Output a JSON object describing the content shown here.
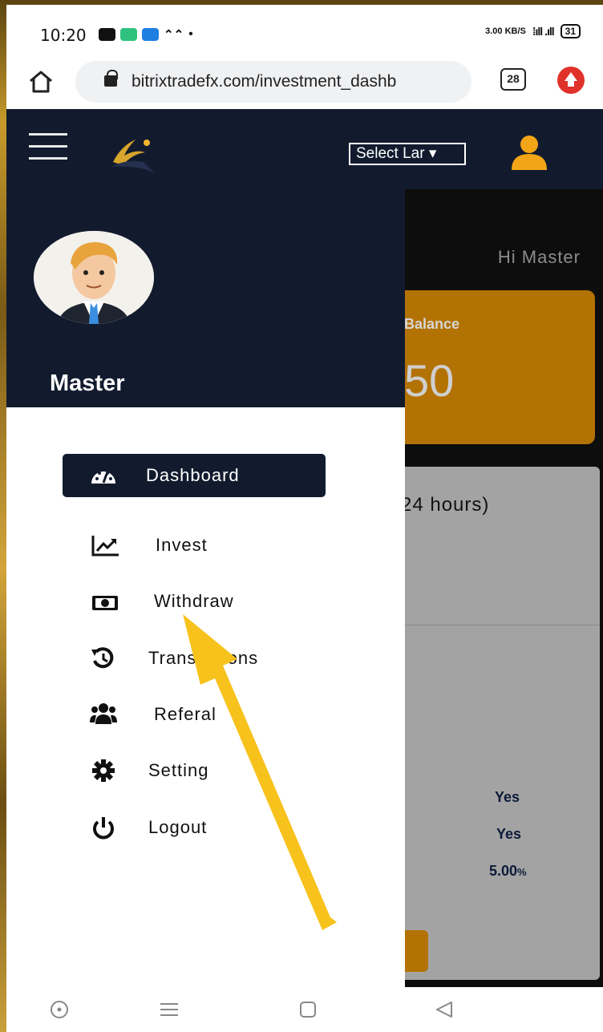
{
  "status_bar": {
    "time": "10:20",
    "net_speed": "3.00 KB/S",
    "battery": "31"
  },
  "browser": {
    "url": "bitrixtradefx.com/investment_dashb",
    "tab_count": "28"
  },
  "header": {
    "language_select": "Select Lar ▾"
  },
  "background_page": {
    "greeting": "Hi Master",
    "balance_label": "Balance",
    "balance_value": "50",
    "hours_text": "24 hours)",
    "yes_1": "Yes",
    "yes_2": "Yes",
    "percent": "5.00",
    "percent_sign": "%"
  },
  "drawer": {
    "username": "Master",
    "items": [
      {
        "label": "Dashboard",
        "icon": "dashboard-icon",
        "active": true
      },
      {
        "label": "Invest",
        "icon": "chart-line-icon",
        "active": false
      },
      {
        "label": "Withdraw",
        "icon": "money-bill-icon",
        "active": false
      },
      {
        "label": "Transactions",
        "icon": "history-icon",
        "active": false
      },
      {
        "label": "Referal",
        "icon": "users-icon",
        "active": false
      },
      {
        "label": "Setting",
        "icon": "gear-icon",
        "active": false
      },
      {
        "label": "Logout",
        "icon": "power-icon",
        "active": false
      }
    ]
  },
  "colors": {
    "navy": "#121b2e",
    "gold": "#b37204",
    "arrow": "#f7c21c",
    "user_icon": "#f2a516"
  }
}
